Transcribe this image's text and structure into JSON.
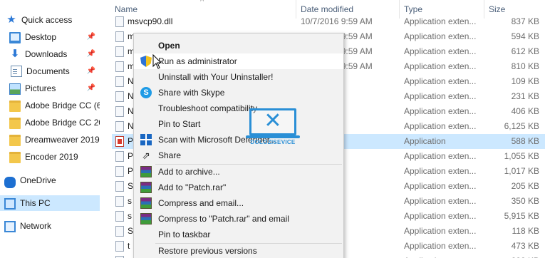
{
  "nav": {
    "items": [
      {
        "label": "Quick access",
        "icon": "star-icon",
        "pinned": false
      },
      {
        "label": "Desktop",
        "icon": "desktop-icon",
        "pinned": true
      },
      {
        "label": "Downloads",
        "icon": "download-icon",
        "pinned": true
      },
      {
        "label": "Documents",
        "icon": "documents-icon",
        "pinned": true
      },
      {
        "label": "Pictures",
        "icon": "pictures-icon",
        "pinned": true
      },
      {
        "label": "Adobe Bridge CC (6",
        "icon": "folder-icon",
        "pinned": false
      },
      {
        "label": "Adobe Bridge CC 20",
        "icon": "folder-icon",
        "pinned": false
      },
      {
        "label": "Dreamweaver 2019",
        "icon": "folder-icon",
        "pinned": false
      },
      {
        "label": "Encoder 2019",
        "icon": "folder-icon",
        "pinned": false
      },
      {
        "label": "OneDrive",
        "icon": "onedrive-icon",
        "pinned": false
      },
      {
        "label": "This PC",
        "icon": "computer-icon",
        "pinned": false,
        "selected": true
      },
      {
        "label": "Network",
        "icon": "network-icon",
        "pinned": false
      }
    ]
  },
  "columns": {
    "name": "Name",
    "date": "Date modified",
    "type": "Type",
    "size": "Size"
  },
  "files": [
    {
      "name": "msvcp90.dll",
      "date": "10/7/2016 9:59 AM",
      "type": "Application exten...",
      "size": "837 KB"
    },
    {
      "name": "m",
      "date": "10/7/2016 9:59 AM",
      "type": "Application exten...",
      "size": "594 KB"
    },
    {
      "name": "m",
      "date": "10/7/2016 9:59 AM",
      "type": "Application exten...",
      "size": "612 KB"
    },
    {
      "name": "m",
      "date": "10/7/2016 9:59 AM",
      "type": "Application exten...",
      "size": "810 KB"
    },
    {
      "name": "N",
      "date": "01 AM",
      "type": "Application exten...",
      "size": "109 KB"
    },
    {
      "name": "N",
      "date": "01 AM",
      "type": "Application exten...",
      "size": "231 KB"
    },
    {
      "name": "N",
      "date": "01 AM",
      "type": "Application exten...",
      "size": "406 KB"
    },
    {
      "name": "N",
      "date": "01 AM",
      "type": "Application exten...",
      "size": "6,125 KB"
    },
    {
      "name": "P",
      "date": "9:22 PM",
      "type": "Application",
      "size": "588 KB",
      "highlight": true,
      "app": true
    },
    {
      "name": "P",
      "date": "01 AM",
      "type": "Application exten...",
      "size": "1,055 KB"
    },
    {
      "name": "P",
      "date": "01 AM",
      "type": "Application exten...",
      "size": "1,017 KB"
    },
    {
      "name": "S",
      "date": "01 AM",
      "type": "Application exten...",
      "size": "205 KB"
    },
    {
      "name": "s",
      "date": "01 AM",
      "type": "Application exten...",
      "size": "350 KB"
    },
    {
      "name": "s",
      "date": "01 AM",
      "type": "Application exten...",
      "size": "5,915 KB"
    },
    {
      "name": "S",
      "date": "01 AM",
      "type": "Application exten...",
      "size": "118 KB"
    },
    {
      "name": "t",
      "date": "01 AM",
      "type": "Application exten...",
      "size": "473 KB"
    },
    {
      "name": "",
      "date": "",
      "type": "Application exten...",
      "size": "222 KB"
    }
  ],
  "context_menu": {
    "items": [
      {
        "label": "Open",
        "bold": true
      },
      {
        "label": "Run as administrator",
        "icon": "uac-shield-icon",
        "hover": true
      },
      {
        "label": "Uninstall with Your Uninstaller!"
      },
      {
        "label": "Share with Skype",
        "icon": "skype-icon"
      },
      {
        "label": "Troubleshoot compatibility"
      },
      {
        "label": "Pin to Start"
      },
      {
        "label": "Scan with Microsoft Defender...",
        "icon": "defender-icon"
      },
      {
        "label": "Share",
        "icon": "share-icon"
      },
      {
        "label": "Add to archive...",
        "icon": "winrar-icon"
      },
      {
        "label": "Add to \"Patch.rar\"",
        "icon": "winrar-icon"
      },
      {
        "label": "Compress and email...",
        "icon": "winrar-icon"
      },
      {
        "label": "Compress to \"Patch.rar\" and email",
        "icon": "winrar-icon"
      },
      {
        "label": "Pin to taskbar"
      },
      {
        "label": "Restore previous versions"
      }
    ]
  },
  "watermark": {
    "text": "DOLOZISEVICE"
  },
  "colors": {
    "selection": "#cce8ff",
    "accent": "#2b78d6",
    "menu_bg": "#f2f2f2"
  }
}
